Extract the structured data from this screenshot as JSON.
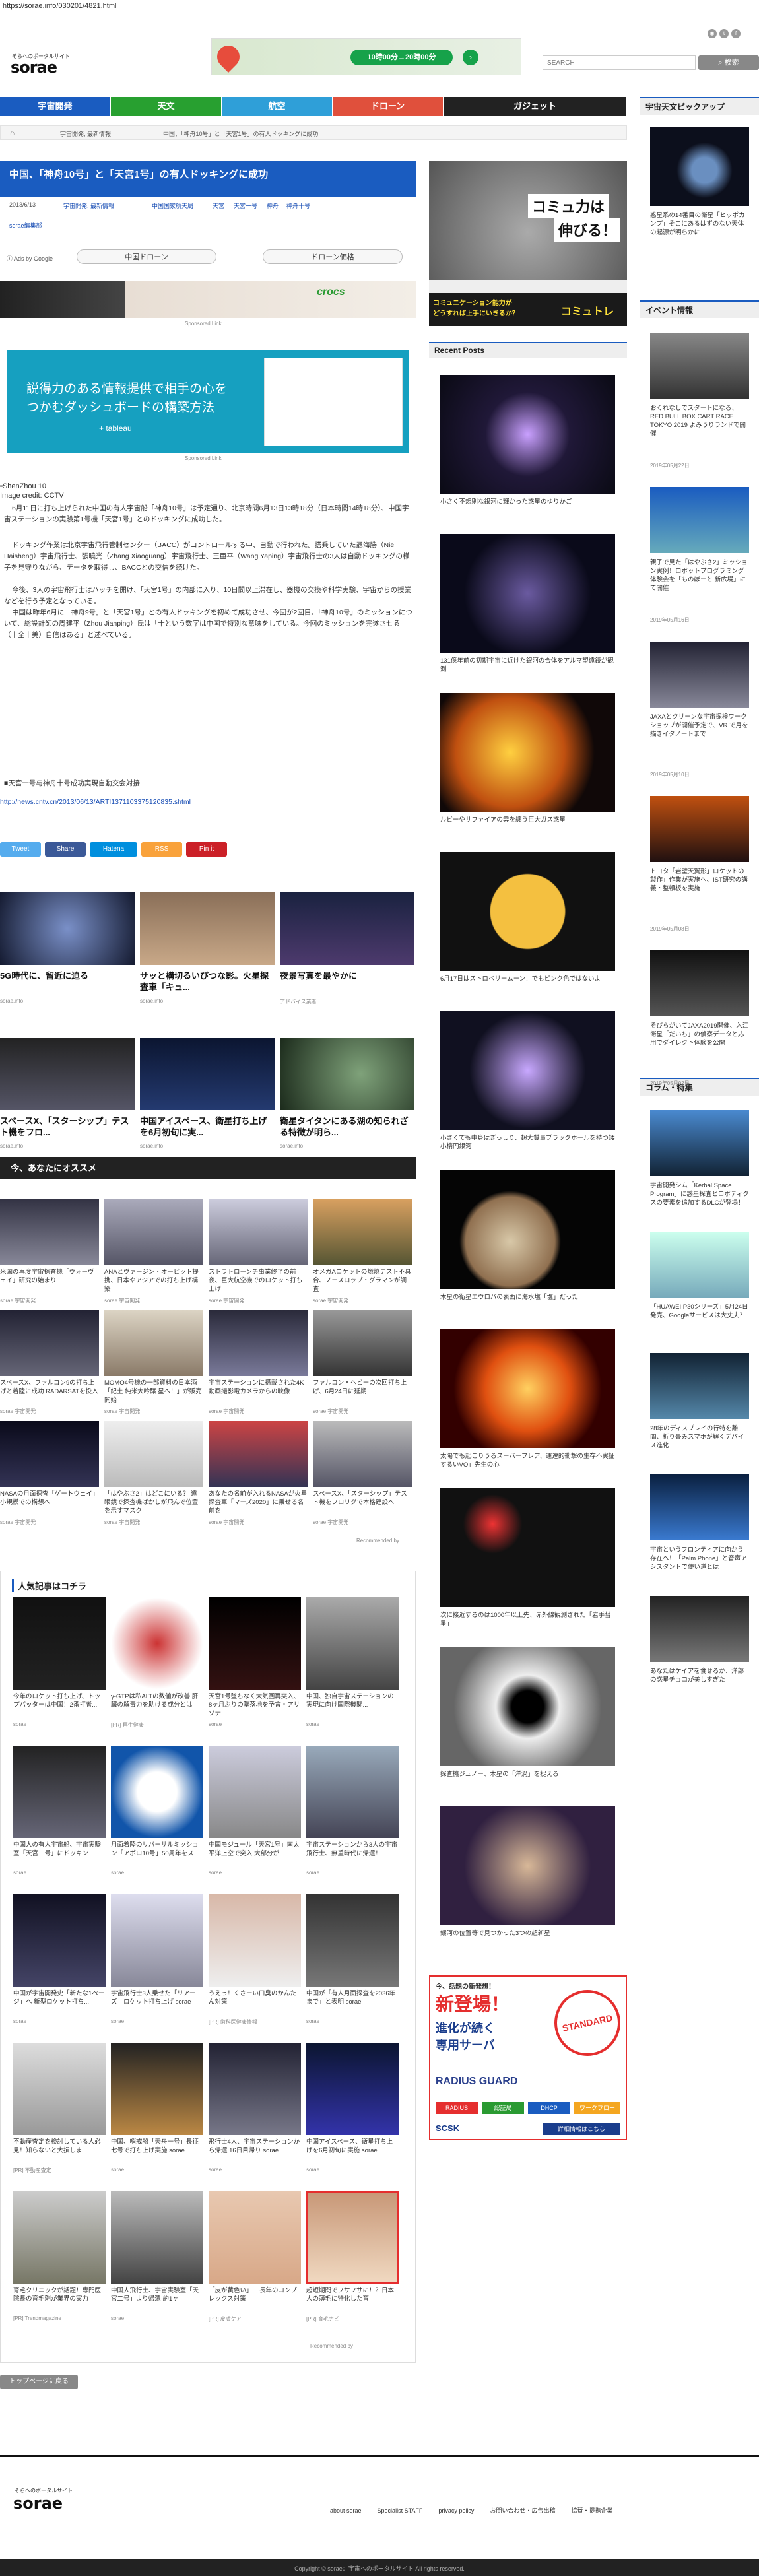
{
  "url_bar": "https://sorae.info/030201/4821.html",
  "header": {
    "tagline": "そらへのポータルサイト",
    "logo": "sorae",
    "ad_text": "10時00分→20時00分",
    "search_placeholder": "SEARCH",
    "search_button": "検索"
  },
  "nav": [
    {
      "label": "宇宙開発",
      "color": "#1a5cc0"
    },
    {
      "label": "天文",
      "color": "#28a030"
    },
    {
      "label": "航空",
      "color": "#2f9fd8"
    },
    {
      "label": "ドローン",
      "color": "#e0503c"
    },
    {
      "label": "ガジェット",
      "color": "#222222"
    }
  ],
  "breadcrumb": {
    "home": "ホーム",
    "cat": "宇宙開発, 最新情報",
    "current": "中国、「神舟10号」と「天宮1号」の有人ドッキングに成功"
  },
  "article": {
    "title": "中国、「神舟10号」と「天宮1号」の有人ドッキングに成功",
    "date": "2013/6/13",
    "tags": [
      "宇宙開発, 最新情報",
      "中国国家航天局",
      "天宮",
      "天宮一号",
      "神舟",
      "神舟十号"
    ],
    "author": "sorae編集部",
    "ads_by": "Ads by Google",
    "ad_btn1": "中国ドローン",
    "ad_btn2": "ドローン価格",
    "sponsored": "Sponsored Link",
    "ad_banner_text": "crocs",
    "ad2_line1": "説得力のある情報提供で相手の心を",
    "ad2_line2": "つかむダッシュボードの構築方法",
    "ad2_brand": "+ tableau",
    "image_alt": "ShenZhou 10",
    "image_credit": "Image credit: CCTV",
    "p1": "6月11日に打ち上げられた中国の有人宇宙船「神舟10号」は予定通り、北京時間6月13日13時18分（日本時間14時18分）、中国宇宙ステーションの実験第1号機「天宮1号」とのドッキングに成功した。",
    "p2": "ドッキング作業は北京宇宙飛行管制センター（BACC）がコントロールする中、自動で行われた。搭乗していた聶海勝（Nie Haisheng）宇宙飛行士、張曉光（Zhang Xiaoguang）宇宙飛行士、王亜平（Wang Yaping）宇宙飛行士の3人は自動ドッキングの様子を見守りながら、データを取得し、BACCとの交信を続けた。",
    "p3": "今後、3人の宇宙飛行士はハッチを開け、「天宮1号」の内部に入り、10日間以上滞在し、器機の交換や科学実験、宇宙からの授業などを行う予定となっている。",
    "p4": "中国は昨年6月に「神舟9号」と「天宮1号」との有人ドッキングを初めて成功させ、今回が2回目。「神舟10号」のミッションについて、総設計師の周建平（Zhou Jianping）氏は「十という数字は中国で特別な意味をしている。今回のミッションを完遂させる（十全十美）自信はある」と述べている。",
    "source_label": "■天宮一号与神舟十号成功実現自動交会対接",
    "source_url": "http://news.cntv.cn/2013/06/13/ARTI1371103375120835.shtml"
  },
  "share": [
    {
      "label": "Tweet",
      "color": "#55acee"
    },
    {
      "label": "Share",
      "color": "#3b5998"
    },
    {
      "label": "Hatena",
      "color": "#008fde"
    },
    {
      "label": "RSS",
      "color": "#f9a23b"
    },
    {
      "label": "Pin it",
      "color": "#cb2027"
    }
  ],
  "related": [
    {
      "title": "5G時代に、留近に迫る",
      "source": "sorae.info"
    },
    {
      "title": "サッと構切るいびつな影。火星探査車「キュ...",
      "source": "sorae.info"
    },
    {
      "title": "夜景写真を最やかに",
      "source": "アドバイス業者"
    },
    {
      "title": "スペースX、「スターシップ」テスト機をフロ...",
      "source": "sorae.info"
    },
    {
      "title": "中国アイスペース、衛星打ち上げを6月初旬に実...",
      "source": "sorae.info"
    },
    {
      "title": "衛星タイタンにある湖の知られざる特徴が明ら...",
      "source": "sorae.info"
    }
  ],
  "recommend_header": "今、あなたにオススメ",
  "recommend": [
    {
      "t": "米国の再度宇宙探査機「ウォーヴェイ」研究の始まり",
      "s": "sorae 宇宙開発"
    },
    {
      "t": "ANAとヴァージン・オービット提携、日本やアジアでの打ち上げ構築",
      "s": "sorae 宇宙開発"
    },
    {
      "t": "ストラトローンチ事業終了の前夜、巨大航空機でのロケット打ち上げ",
      "s": "sorae 宇宙開発"
    },
    {
      "t": "オメガAロケットの燃焼テスト不具合、ノースロップ・グラマンが調査",
      "s": "sorae 宇宙開発"
    },
    {
      "t": "スペースX、ファルコン9の打ち上げと着陸に成功 RADARSATを投入",
      "s": "sorae 宇宙開発"
    },
    {
      "t": "MOMO4号機の一部資料の日本酒「紀土 純米大吟醸 星へ！」が販売開始",
      "s": "sorae 宇宙開発"
    },
    {
      "t": "宇宙ステーションに搭載された4K動画撮影電カメラからの映像",
      "s": "sorae 宇宙開発"
    },
    {
      "t": "ファルコン・ヘビーの次回打ち上げ、6月24日に延期",
      "s": "sorae 宇宙開発"
    },
    {
      "t": "NASAの月面探査「ゲートウェイ」小規模での構想へ",
      "s": "sorae 宇宙開発"
    },
    {
      "t": "「はやぶさ2」はどこにいる？ 遠眼鏡で探査機ばかしが飛んで位置を示すマスク",
      "s": "sorae 宇宙開発"
    },
    {
      "t": "あなたの名前が入れるNASAが火星探査車「マーズ2020」に乗せる名前を",
      "s": "sorae 宇宙開発"
    },
    {
      "t": "スペースX、「スターシップ」テスト機をフロリダで本格建設へ",
      "s": "sorae 宇宙開発"
    }
  ],
  "recommended_by": "Recommended by",
  "popular_header": "人気記事はコチラ",
  "popular": [
    {
      "t": "今年のロケット打ち上げ、トップバッターは中国！2番打者...",
      "s": "sorae"
    },
    {
      "t": "γ-GTPは私ALTの数値が改善!肝臓の解毒力を助ける成分とは",
      "s": "[PR] 再生健康"
    },
    {
      "t": "天宮1号墜ちなく大気圏再突入、8ヶ月ぶりの墜落地を予言・アリゾナ...",
      "s": "sorae"
    },
    {
      "t": "中国、独自宇宙ステーションの実現に向け国際機関...",
      "s": "sorae"
    },
    {
      "t": "中国人の有人宇宙船、宇宙実験室「天宮二号」にドッキン...",
      "s": "sorae"
    },
    {
      "t": "月面着陸のリバーサルミッション「アポロ10号」50周年をス",
      "s": "sorae"
    },
    {
      "t": "中国モジュール「天宮1号」南太平洋上空で突入 大部分が...",
      "s": "sorae"
    },
    {
      "t": "宇宙ステーションから3人の宇宙飛行士、無重時代に帰還！",
      "s": "sorae"
    },
    {
      "t": "中国が宇宙開発史「新たな1ページ」へ 新型ロケット打ち...",
      "s": "sorae"
    },
    {
      "t": "宇宙飛行士3人乗せた「リアーズ」ロケット打ち上げ sorae",
      "s": "sorae"
    },
    {
      "t": "うえっ！くさーい口臭のかんたん対策",
      "s": "[PR] 歯科医健康情報"
    },
    {
      "t": "中国が「有人月面探査を2036年まで」と表明 sorae",
      "s": "sorae"
    },
    {
      "t": "不動産査定を検討している人必見！知らないと大損しま",
      "s": "[PR] 不動産査定"
    },
    {
      "t": "中国、哨戒船「天舟一号」長征七号で打ち上げ実施 sorae",
      "s": "sorae"
    },
    {
      "t": "飛行士4人、宇宙ステーションから帰還 16日目帰り sorae",
      "s": "sorae"
    },
    {
      "t": "中国アイスペース、衛星打ち上げを6月初旬に実施 sorae",
      "s": "sorae"
    },
    {
      "t": "育毛クリニックが話題！専門医院長の育毛剤が業界の実力",
      "s": "[PR] Trendmagazine"
    },
    {
      "t": "中国人飛行士、宇宙実験室「天宮二号」より帰還 約1ヶ",
      "s": "sorae"
    },
    {
      "t": "「皮が黄色い」... 長年のコンプレックス対策",
      "s": "[PR] 皮膚ケア"
    },
    {
      "t": "超短期間でフサフサに！？日本人の薄毛に特化した育",
      "s": "[PR] 育毛ナビ"
    }
  ],
  "recommended_by2": "Recommended by",
  "more_button": "トップページに戻る",
  "middle_ad": {
    "line1": "コミュ力は",
    "line2": "伸びる！",
    "line3": "コミュニケーション能力が",
    "line4": "どうすれば上手にいきるか？",
    "brand": "コミュトレ"
  },
  "recent_header": "Recent Posts",
  "recent": [
    {
      "t": "小さく不規則な銀河に輝かった惑星のゆりかご"
    },
    {
      "t": "131億年前の初期宇宙に近けた銀河の合体をアルマ望遠鏡が観測"
    },
    {
      "t": "ルビーやサファイアの雲を纏う巨大ガス惑星"
    },
    {
      "t": "6月17日はストロベリームーン！でもピンク色ではないよ"
    },
    {
      "t": "小さくても中身はぎっしり、超大質量ブラックホールを持つ矮小楕円銀河"
    },
    {
      "t": "木星の衛星エウロパの表面に海水塩「塩」だった"
    },
    {
      "t": "太陽でも起こりうるスーパーフレア、運速的衝撃の生存不実証するいVO」先生の心"
    },
    {
      "t": "次に接近するのは1000年以上先、赤外線観測された「岩手彗星」"
    },
    {
      "t": "探査機ジュノー、木星の「洋渦」を捉える"
    },
    {
      "t": "銀河の位置等で見つかった3つの超新星"
    }
  ],
  "bottom_ad": {
    "line1": "今、話題の新発想！",
    "line2": "新登場！",
    "line3": "進化が続く",
    "line4": "専用サーバ",
    "brand": "SCSK",
    "badge": "STANDARD",
    "sub": "RADIUS GUARD",
    "btns": [
      "RADIUS",
      "認証局",
      "DHCP",
      "ワークフロー"
    ],
    "link": "詳細情報はこちら"
  },
  "right": {
    "pickup_header": "宇宙天文ピックアップ",
    "pickup_item": "惑星系の14番目の衛星「ヒッポカンプ」そこにあるはずのない天体の起源が明らかに",
    "events_header": "イベント情報",
    "events": [
      {
        "t": "おくれなしでスタートになる、RED BULL BOX CART RACE TOKYO 2019 よみうりランドで開催",
        "d": "2019年05月22日"
      },
      {
        "t": "親子で見た「はやぶさ2」ミッション実例！ロボットプログラミング体験会を「ものぽーと 新広場」にて開催",
        "d": "2019年05月16日"
      },
      {
        "t": "JAXAとクリーンな宇宙探検ワークショップが開催予定で、VR で月を描きイタノートまで",
        "d": "2019年05月10日"
      },
      {
        "t": "トヨタ「岩壁天翼形」ロケットの製作」作業が実施へ、IST研究の講義・整頓板を実施",
        "d": "2019年05月08日"
      },
      {
        "t": "そびらがいてJAXA2019開催、入江衛星「だいち」の偵察データと応用でダイレクト体験を公開",
        "d": "2019年05月02日"
      }
    ],
    "column_header": "コラム・特集",
    "column": [
      {
        "t": "宇宙開発シム「Kerbal Space Program」に惑星探査とロボティクスの要素を追加するDLCが登場！"
      },
      {
        "t": "「HUAWEI P30シリーズ」5月24日発売、Googleサービスは大丈夫？"
      },
      {
        "t": "28年のディスプレイの行特を離間、折り畳みスマホが解くデバイス進化"
      },
      {
        "t": "宇宙というフロンティアに向かう存在へ！「Palm Phone」と音声アシスタントで使い道とは"
      },
      {
        "t": "あなたはケイアを食せるか、洋部の惑星チョコが美しすぎた"
      }
    ]
  },
  "footer": {
    "tagline": "そらへのポータルサイト",
    "logo": "sorae",
    "links": [
      "about sorae",
      "Specialist STAFF",
      "privacy policy",
      "お問い合わせ・広告出稿",
      "協賛・提携企業"
    ],
    "copyright": "Copyright © sorae：宇宙へのポータルサイト All rights reserved."
  }
}
